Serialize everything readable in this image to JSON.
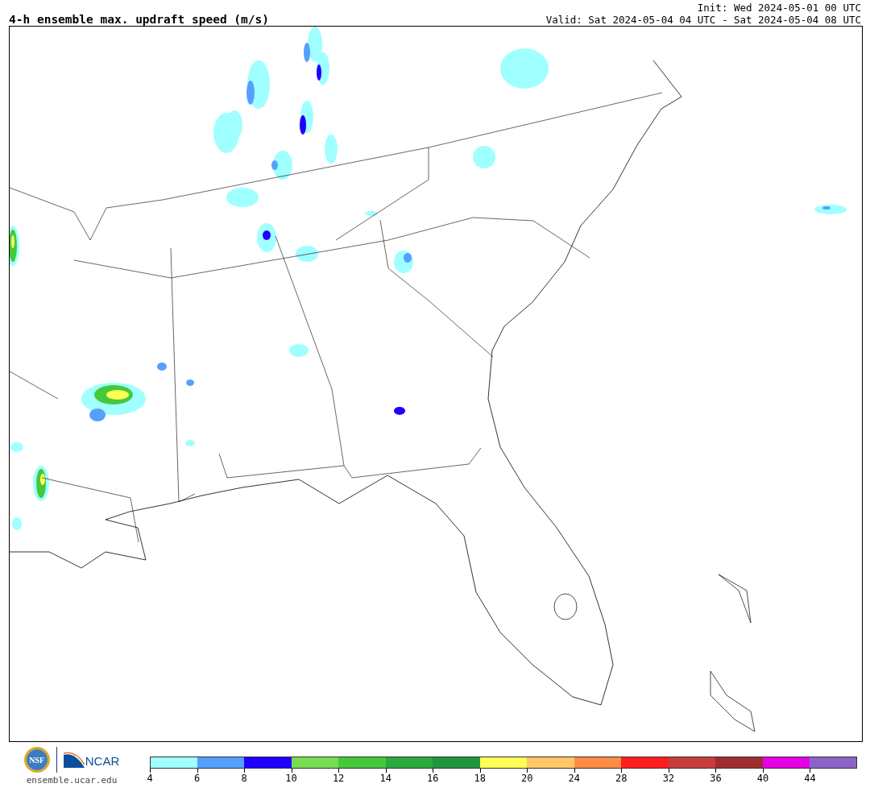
{
  "title": "4-h ensemble max. updraft speed (m/s)",
  "init": "Init: Wed 2024-05-01 00 UTC",
  "valid": "Valid: Sat 2024-05-04 04 UTC - Sat 2024-05-04 08 UTC",
  "logos": {
    "nsf": "NSF",
    "ncar": "NCAR",
    "url": "ensemble.ucar.edu"
  },
  "colorbar": [
    {
      "label": "4",
      "color": "#a0ffff"
    },
    {
      "label": "6",
      "color": "#55a0ff"
    },
    {
      "label": "8",
      "color": "#1e00ff"
    },
    {
      "label": "10",
      "color": "#78dc50"
    },
    {
      "label": "12",
      "color": "#46c83c"
    },
    {
      "label": "14",
      "color": "#28aa3c"
    },
    {
      "label": "16",
      "color": "#1e963c"
    },
    {
      "label": "18",
      "color": "#ffff55"
    },
    {
      "label": "20",
      "color": "#ffc864"
    },
    {
      "label": "24",
      "color": "#ff8c46"
    },
    {
      "label": "28",
      "color": "#ff1e1e"
    },
    {
      "label": "32",
      "color": "#c83c3c"
    },
    {
      "label": "36",
      "color": "#a02d2d"
    },
    {
      "label": "40",
      "color": "#e600e6"
    },
    {
      "label": "44",
      "color": "#8c64c8"
    }
  ]
}
